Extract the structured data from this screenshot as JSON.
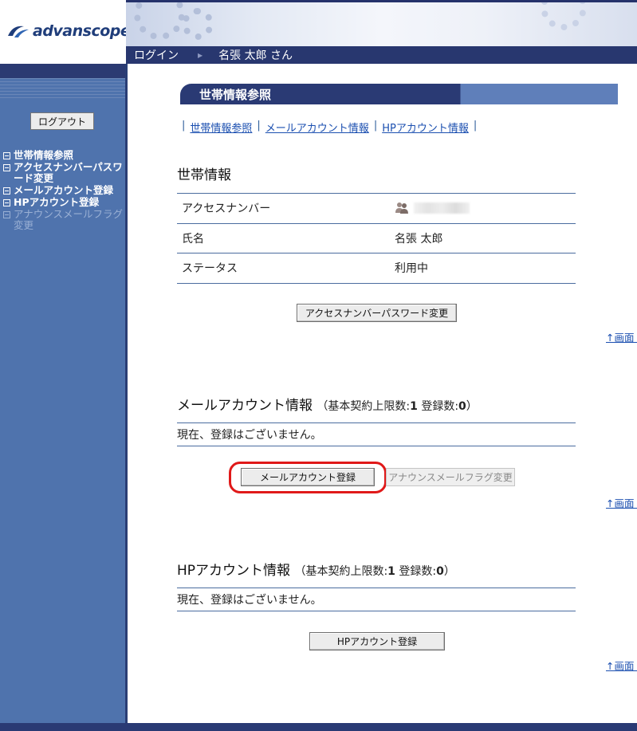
{
  "brand": {
    "name": "advanscope"
  },
  "userbar": {
    "login_label": "ログイン",
    "user_name": "名張 太郎 さん"
  },
  "sidebar": {
    "logout_label": "ログアウト",
    "items": [
      {
        "label": "世帯情報参照",
        "enabled": true
      },
      {
        "label": "アクセスナンバーパスワード変更",
        "enabled": true
      },
      {
        "label": "メールアカウント登録",
        "enabled": true
      },
      {
        "label": "HPアカウント登録",
        "enabled": true
      },
      {
        "label": "アナウンスメールフラグ変更",
        "enabled": false
      }
    ]
  },
  "page_title": "世帯情報参照",
  "tabs": [
    {
      "label": "世帯情報参照"
    },
    {
      "label": "メールアカウント情報"
    },
    {
      "label": "HPアカウント情報"
    }
  ],
  "household": {
    "title": "世帯情報",
    "rows": [
      {
        "key": "アクセスナンバー",
        "value": ""
      },
      {
        "key": "氏名",
        "value": "名張 太郎"
      },
      {
        "key": "ステータス",
        "value": "利用中"
      }
    ],
    "password_button": "アクセスナンバーパスワード変更"
  },
  "mail": {
    "title": "メールアカウント情報",
    "limit_prefix": "（基本契約上限数:",
    "limit_value": "1",
    "count_prefix": "登録数:",
    "count_value": "0",
    "suffix": "）",
    "empty_text": "現在、登録はございません。",
    "register_button": "メールアカウント登録",
    "flag_button": "アナウンスメールフラグ変更"
  },
  "hp": {
    "title": "HPアカウント情報",
    "limit_prefix": "（基本契約上限数:",
    "limit_value": "1",
    "count_prefix": "登録数:",
    "count_value": "0",
    "suffix": "）",
    "empty_text": "現在、登録はございません。",
    "register_button": "HPアカウント登録"
  },
  "top_link": "↑画面トップへ",
  "colors": {
    "nav_dark": "#2a3a74",
    "sidebar": "#4f73ad",
    "highlight": "#e01919"
  }
}
